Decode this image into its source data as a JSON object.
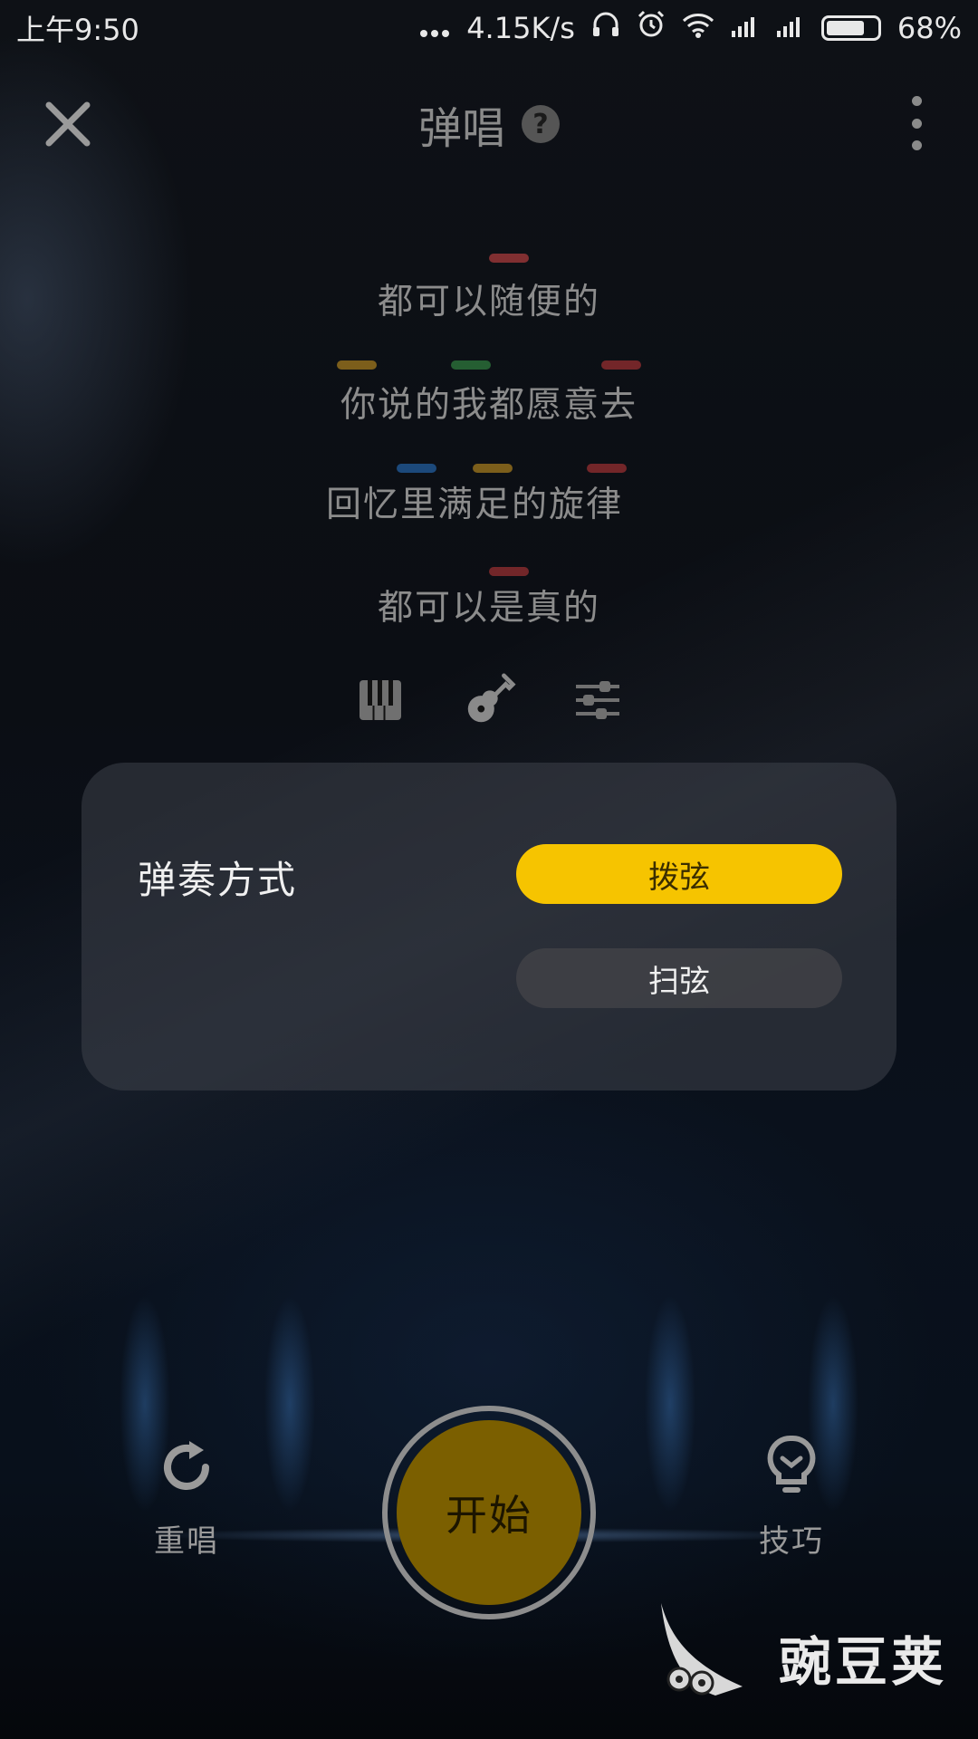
{
  "status_bar": {
    "time": "上午9:50",
    "network_speed": "4.15K/s",
    "battery_percent": "68%",
    "battery_level": 0.68,
    "icons": [
      "more-dots-icon",
      "headphones-icon",
      "alarm-icon",
      "wifi-icon",
      "signal-icon",
      "signal-icon",
      "battery-icon"
    ]
  },
  "header": {
    "title": "弹唱",
    "help": "?",
    "close_icon": "close-icon",
    "more_icon": "more-vertical-icon"
  },
  "lyrics": {
    "lines": [
      "都可以随便的",
      "你说的我都愿意去",
      "回忆里满足的旋律",
      "都可以是真的"
    ],
    "chord_colors": [
      "#e04848",
      "#d8a020",
      "#3aa04a",
      "#c83a3a",
      "#2a7ad0"
    ]
  },
  "instruments": {
    "items": [
      "piano-icon",
      "guitar-icon",
      "sliders-icon"
    ],
    "selected": "guitar-icon"
  },
  "play_mode_panel": {
    "label": "弹奏方式",
    "options": [
      {
        "label": "拨弦",
        "selected": true
      },
      {
        "label": "扫弦",
        "selected": false
      }
    ],
    "accent": "#f6c400"
  },
  "controls": {
    "restart_label": "重唱",
    "start_label": "开始",
    "tips_label": "技巧",
    "start_color": "#7b5f00"
  },
  "watermark": {
    "text": "豌豆荚"
  }
}
